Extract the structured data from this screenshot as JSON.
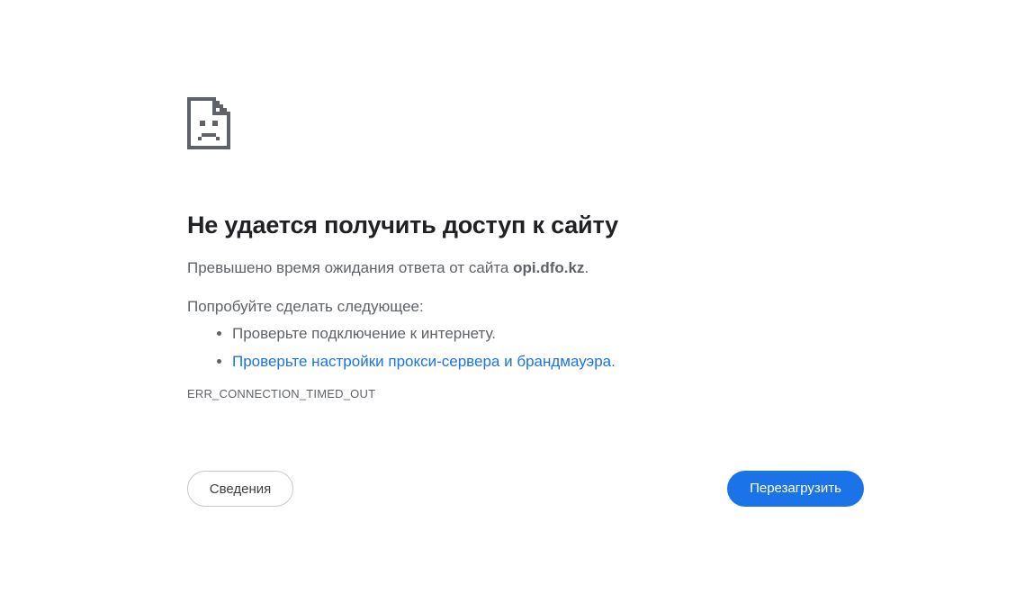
{
  "error": {
    "icon": "sad-page-icon",
    "title": "Не удается получить доступ к сайту",
    "description_prefix": "Превышено время ожидания ответа от сайта ",
    "host": "opi.dfo.kz",
    "description_suffix": ".",
    "suggestions_heading": "Попробуйте сделать следующее:",
    "suggestions": [
      "Проверьте подключение к интернету.",
      "Проверьте настройки прокси-сервера и брандмауэра"
    ],
    "suggestion_link_suffix": ".",
    "code": "ERR_CONNECTION_TIMED_OUT"
  },
  "buttons": {
    "details_label": "Сведения",
    "reload_label": "Перезагрузить"
  },
  "colors": {
    "accent": "#1a73e8",
    "title": "#202124",
    "text": "#5f6368"
  }
}
